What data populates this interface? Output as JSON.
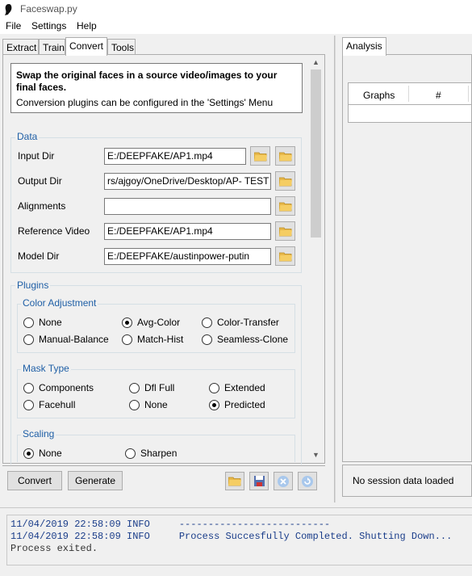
{
  "app": {
    "title": "Faceswap.py"
  },
  "menu": [
    "File",
    "Settings",
    "Help"
  ],
  "tabs": [
    "Extract",
    "Train",
    "Convert",
    "Tools"
  ],
  "right_tab": "Analysis",
  "info": {
    "title": "Swap the original faces in a source video/images to your final faces.",
    "description": "Conversion plugins can be configured in the 'Settings' Menu"
  },
  "data_section": {
    "label": "Data",
    "fields": [
      {
        "label": "Input Dir",
        "value": "E:/DEEPFAKE/AP1.mp4"
      },
      {
        "label": "Output Dir",
        "value": "rs/ajgoy/OneDrive/Desktop/AP- TEST"
      },
      {
        "label": "Alignments",
        "value": ""
      },
      {
        "label": "Reference Video",
        "value": "E:/DEEPFAKE/AP1.mp4"
      },
      {
        "label": "Model Dir",
        "value": "E:/DEEPFAKE/austinpower-putin"
      }
    ]
  },
  "plugins": {
    "label": "Plugins",
    "color_adjustment": {
      "label": "Color Adjustment",
      "options": [
        "None",
        "Avg-Color",
        "Color-Transfer",
        "Manual-Balance",
        "Match-Hist",
        "Seamless-Clone"
      ],
      "selected": "Avg-Color"
    },
    "mask_type": {
      "label": "Mask Type",
      "options": [
        "Components",
        "Dfl Full",
        "Extended",
        "Facehull",
        "None",
        "Predicted"
      ],
      "selected": "Predicted"
    },
    "scaling": {
      "label": "Scaling",
      "options": [
        "None",
        "Sharpen"
      ],
      "selected": "None"
    }
  },
  "buttons": {
    "convert": "Convert",
    "generate": "Generate"
  },
  "analysis": {
    "columns": [
      "Graphs",
      "#"
    ],
    "status": "No session data loaded"
  },
  "console": [
    {
      "time": "11/04/2019 22:58:09",
      "level": "INFO",
      "msg": "--------------------------"
    },
    {
      "time": "11/04/2019 22:58:09",
      "level": "INFO",
      "msg": "Process Succesfully Completed. Shutting Down..."
    },
    {
      "time": "",
      "level": "",
      "msg": "Process exited."
    }
  ],
  "colors": {
    "group_label": "#1f5fa6",
    "folder": "#e8b84a",
    "console_text": "#1a3d8a"
  }
}
